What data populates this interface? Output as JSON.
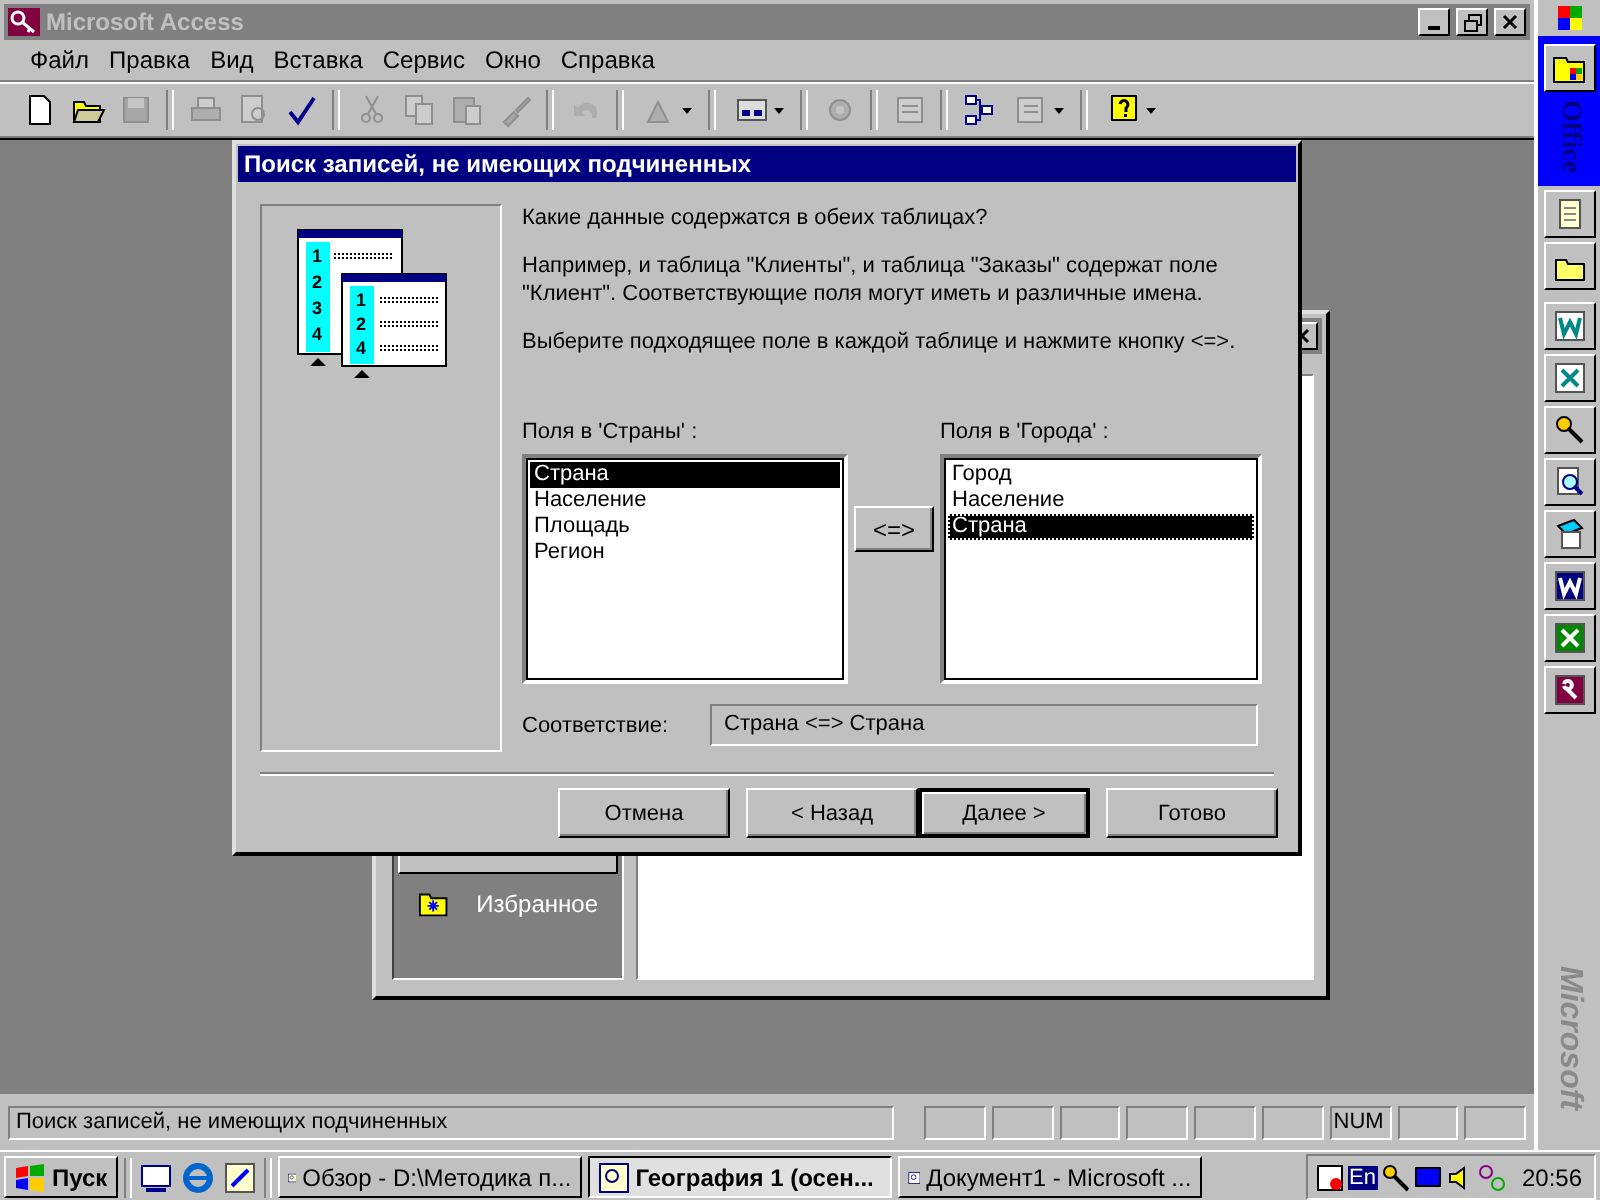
{
  "app_window": {
    "title": "Microsoft Access"
  },
  "menu": [
    {
      "label": "Файл"
    },
    {
      "label": "Правка"
    },
    {
      "label": "Вид"
    },
    {
      "label": "Вставка"
    },
    {
      "label": "Сервис"
    },
    {
      "label": "Окно"
    },
    {
      "label": "Справка"
    }
  ],
  "toolbar": [
    {
      "disabled": false
    },
    {
      "disabled": false
    },
    {
      "disabled": true
    },
    {
      "disabled": true
    },
    {
      "disabled": true
    },
    {
      "disabled": false
    },
    {
      "disabled": true
    },
    {
      "disabled": true
    },
    {
      "disabled": true
    },
    {
      "disabled": true
    },
    {
      "disabled": true
    },
    {
      "disabled": true
    },
    {
      "disabled": false
    },
    {
      "disabled": true
    },
    {
      "disabled": true
    },
    {
      "disabled": false
    },
    {
      "disabled": true
    },
    {
      "disabled": false
    }
  ],
  "database_window": {
    "favorites": "Избранное"
  },
  "dialog": {
    "title": "Поиск записей, не имеющих подчиненных",
    "illustration": {
      "left_rows": [
        "1",
        "2",
        "3",
        "4"
      ],
      "right_rows": [
        "1",
        "2",
        "4"
      ]
    },
    "question": "Какие данные содержатся в обеих таблицах?",
    "example": "Например, и таблица \"Клиенты\", и таблица \"Заказы\" содержат поле \"Клиент\". Соответствующие поля могут иметь и различные имена.",
    "instruction": "Выберите подходящее поле в каждой таблице и нажмите кнопку <=>.",
    "left_list": {
      "label": "Поля в 'Страны' :",
      "items": [
        {
          "label": "Страна",
          "selected": true
        },
        {
          "label": "Население",
          "selected": false
        },
        {
          "label": "Площадь",
          "selected": false
        },
        {
          "label": "Регион",
          "selected": false
        }
      ]
    },
    "match_button": "<=>",
    "right_list": {
      "label": "Поля в 'Города' :",
      "items": [
        {
          "label": "Город",
          "selected": false
        },
        {
          "label": "Население",
          "selected": false
        },
        {
          "label": "Страна",
          "selected": true
        }
      ]
    },
    "match": {
      "label": "Соответствие:",
      "value": "Страна <=> Страна"
    },
    "buttons": [
      {
        "label": "Отмена",
        "default": false
      },
      {
        "label": "< Назад",
        "default": false
      },
      {
        "label": "Далее >",
        "default": true
      },
      {
        "label": "Готово",
        "default": false
      }
    ]
  },
  "status_bar": {
    "text": "Поиск записей, не имеющих подчиненных",
    "num": "NUM"
  },
  "office_bar": {
    "title": "Office",
    "brand": "Microsoft"
  },
  "taskbar": {
    "start": "Пуск",
    "tasks": [
      {
        "label": "Обзор - D:\\Методика п...",
        "selected": false
      },
      {
        "label": "География 1 (осен...",
        "selected": true
      },
      {
        "label": "Документ1 - Microsoft ...",
        "selected": false
      }
    ],
    "language": "En",
    "time": "20:56"
  }
}
